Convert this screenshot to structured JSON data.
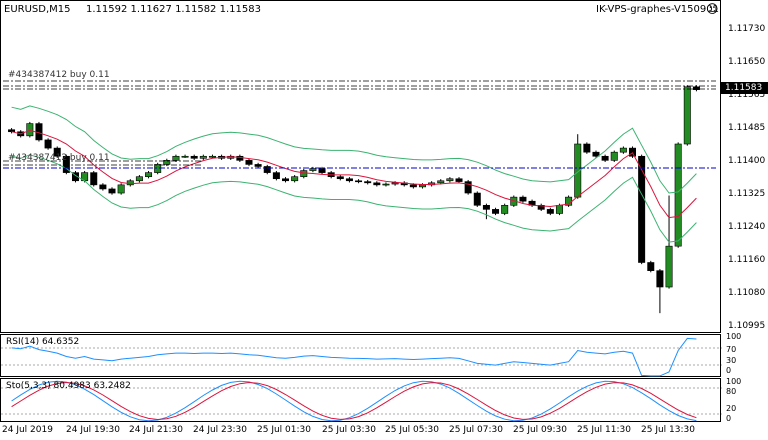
{
  "chart_header": {
    "symbol": "EURUSD,M15",
    "ohlc": "1.11592 1.11627 1.11582 1.11583",
    "server": "IK-VPS-graphes-V150901",
    "smiley": "☺"
  },
  "order_labels": {
    "top": "#434387412 buy 0.11",
    "mid": "#434387412 buy 0.11"
  },
  "current_price": "1.11583",
  "colors": {
    "bull": "#228B22",
    "bear": "#000000",
    "bollinger": "#3CB371",
    "ma": "#DC143C",
    "order_line": "#000000",
    "order_line_blue": "#0000CD",
    "rsi": "#1E90FF",
    "stoch_main": "#1E90FF",
    "stoch_signal": "#DC143C"
  },
  "chart_data": [
    {
      "type": "candlestick",
      "title": "EURUSD,M15",
      "y_ticks": [
        "1.11730",
        "1.11650",
        "1.11565",
        "1.11485",
        "1.11400",
        "1.11325",
        "1.11240",
        "1.11160",
        "1.11080",
        "1.10995"
      ],
      "ylim": [
        1.10985,
        1.118
      ],
      "x_ticks": [
        "24 Jul 2019",
        "24 Jul 19:30",
        "24 Jul 21:30",
        "24 Jul 23:30",
        "25 Jul 01:30",
        "25 Jul 03:30",
        "25 Jul 05:30",
        "25 Jul 07:30",
        "25 Jul 09:30",
        "25 Jul 11:30",
        "25 Jul 13:30"
      ],
      "indicators": [
        "Bollinger Bands",
        "Moving Average"
      ]
    },
    {
      "type": "line",
      "title": "RSI(14) 64.6352",
      "y_ticks": [
        "100",
        "70",
        "30",
        "0"
      ],
      "ylim": [
        0,
        100
      ]
    },
    {
      "type": "line",
      "title": "Sto(5,3,3) 80.4983 63.2482",
      "y_ticks": [
        "100",
        "80",
        "20",
        "0"
      ],
      "ylim": [
        0,
        100
      ]
    }
  ]
}
